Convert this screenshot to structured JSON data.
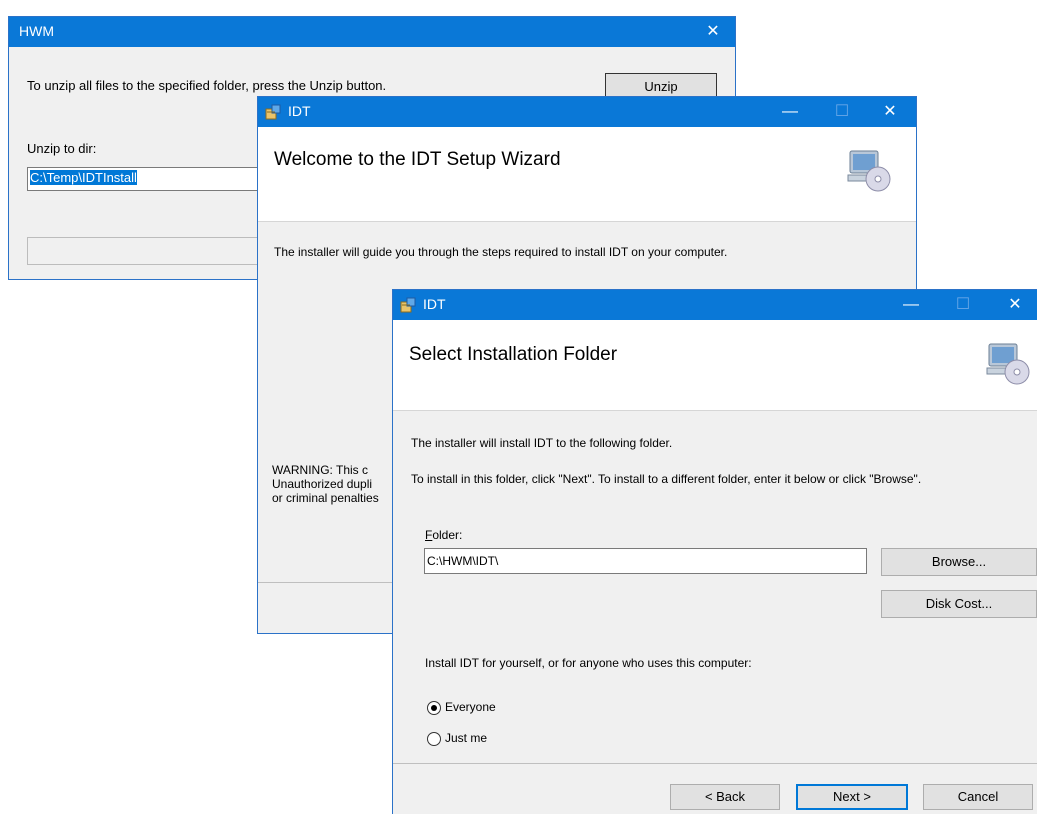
{
  "hwm": {
    "title": "HWM",
    "close_glyph": "✕",
    "instruction": "To unzip all files to the specified folder, press the Unzip button.",
    "unzip_button": "Unzip",
    "dir_label": "Unzip to dir:",
    "dir_value": "C:\\Temp\\IDTInstall"
  },
  "wizard_welcome": {
    "title": "IDT",
    "minimize_glyph": "—",
    "maximize_glyph": "☐",
    "close_glyph": "✕",
    "heading": "Welcome to the IDT Setup Wizard",
    "intro": "The installer will guide you through the steps required to install IDT on your computer.",
    "warning_line1": "WARNING: This c",
    "warning_line2": "Unauthorized dupli",
    "warning_line3": "or criminal penalties"
  },
  "wizard_folder": {
    "title": "IDT",
    "minimize_glyph": "—",
    "maximize_glyph": "☐",
    "close_glyph": "✕",
    "heading": "Select Installation Folder",
    "line1": "The installer will install IDT to the following folder.",
    "line2": "To install in this folder, click \"Next\". To install to a different folder, enter it below or click \"Browse\".",
    "folder_label_accel": "F",
    "folder_label_rest": "older:",
    "folder_value": "C:\\HWM\\IDT\\",
    "browse_button": "Browse...",
    "disk_cost_button": "Disk Cost...",
    "install_for": "Install IDT for yourself, or for anyone who uses this computer:",
    "options": [
      {
        "label": "Everyone",
        "checked": true
      },
      {
        "label": "Just me",
        "checked": false
      }
    ],
    "back_button": "< Back",
    "next_button": "Next >",
    "cancel_button": "Cancel"
  },
  "icons": {
    "app": "installer-box-icon",
    "setup": "computer-with-disc-icon"
  },
  "colors": {
    "titlebar": "#0a78d7",
    "selection": "#0078d7",
    "dialog_bg": "#f0f0f0"
  }
}
